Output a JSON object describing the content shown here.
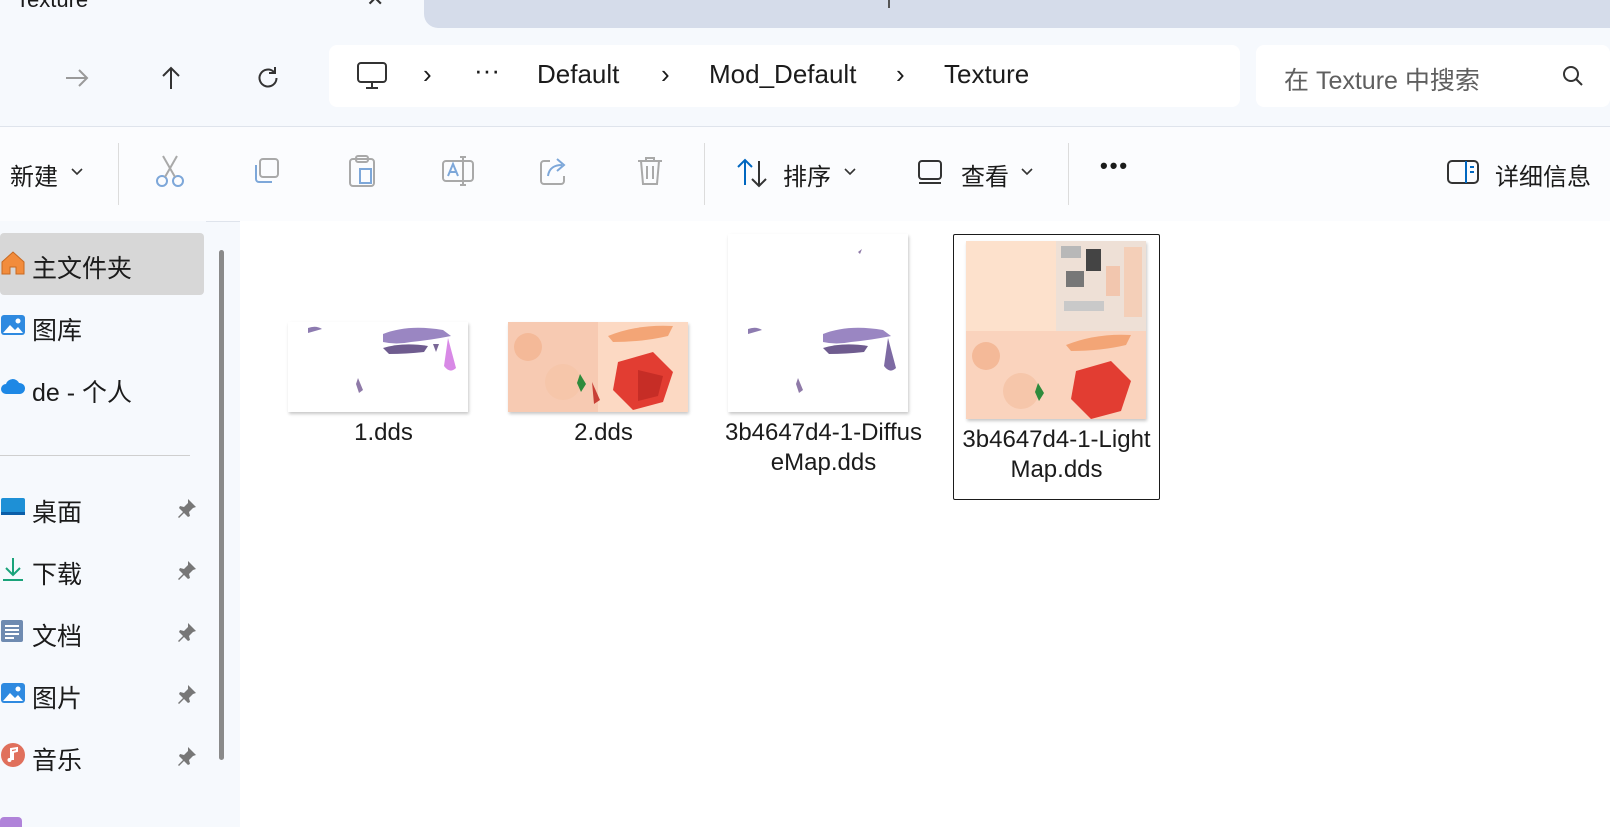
{
  "window": {
    "tab_title": "Texture",
    "tab_close": "✕"
  },
  "nav": {
    "breadcrumb": [
      "Default",
      "Mod_Default",
      "Texture"
    ],
    "separator": "›",
    "overflow": "···"
  },
  "search": {
    "placeholder": "在 Texture 中搜索"
  },
  "toolbar": {
    "new_label": "新建",
    "sort_label": "排序",
    "view_label": "查看",
    "more_label": "•••",
    "details_label": "详细信息"
  },
  "sidebar": {
    "items": [
      {
        "label": "主文件夹",
        "icon": "home-icon"
      },
      {
        "label": "图库",
        "icon": "gallery-icon"
      },
      {
        "label": "de - 个人",
        "icon": "onedrive-icon"
      }
    ],
    "pinned": [
      {
        "label": "桌面",
        "icon": "desktop-icon"
      },
      {
        "label": "下载",
        "icon": "download-icon"
      },
      {
        "label": "文档",
        "icon": "documents-icon"
      },
      {
        "label": "图片",
        "icon": "pictures-icon"
      },
      {
        "label": "音乐",
        "icon": "music-icon"
      }
    ]
  },
  "files": [
    {
      "name": "1.dds"
    },
    {
      "name": "2.dds"
    },
    {
      "name": "3b4647d4-1-DiffuseMap.dds"
    },
    {
      "name": "3b4647d4-1-LightMap.dds",
      "selected": true
    }
  ],
  "colors": {
    "accent": "#0067c0",
    "selected_sidebar": "#d7d7d7",
    "content_bg": "#ffffff",
    "chrome_bg": "#f6f9fd"
  }
}
